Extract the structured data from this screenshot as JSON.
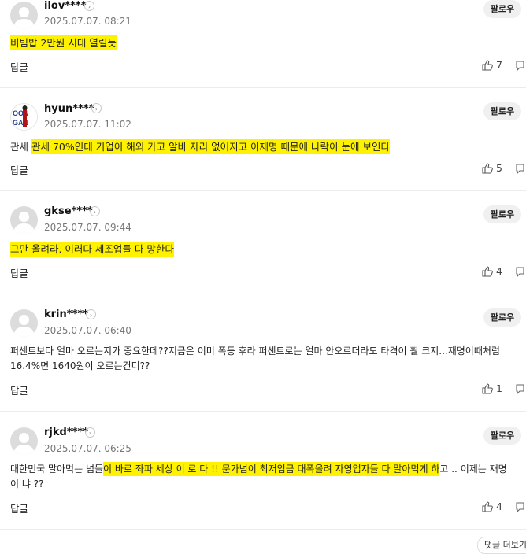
{
  "follow_label": "팔로우",
  "reply_label": "답글",
  "comments": [
    {
      "user": "ilov****",
      "date": "2025.07.07. 08:21",
      "text": "비빔밥 2만원 시대 열릴듯",
      "likes": "7"
    },
    {
      "user": "hyun****",
      "date": "2025.07.07. 11:02",
      "text": "관세 70%인데 기업이 해외 가고 알바 자리 없어지고 이재명 때문에 나락이 눈에 보인다",
      "likes": "5"
    },
    {
      "user": "gkse****",
      "date": "2025.07.07. 09:44",
      "text": "그만 올려라. 이러다 제조업들 다 망한다",
      "likes": "4"
    },
    {
      "user": "krin****",
      "date": "2025.07.07. 06:40",
      "text_line1": "퍼센트보다 얼마 오르는지가 중요한데??지금은 이미 폭등 후라 퍼센트로는 얼마 안오르더라도 타격이 훨 크지...재명이때처럼",
      "text_line2": "16.4%면 1640원이 오르는건디??",
      "likes": "1"
    },
    {
      "user": "rjkd****",
      "date": "2025.07.07. 06:25",
      "text_pre": "대한민국 말아먹는 넘들",
      "text_hl": "이 바로 좌파 세상 이 로 다 !! 문가넘이 최저임금 대폭올려 자영업자들 다 말아먹게 하",
      "text_post": "고 .. 이제는 재명",
      "text_line2": "이 냐 ??",
      "likes": "4"
    }
  ],
  "bottom_button": "댓글 더보기",
  "colors": {
    "highlight": "#fff200",
    "follow_bg": "#f0f0f0"
  }
}
